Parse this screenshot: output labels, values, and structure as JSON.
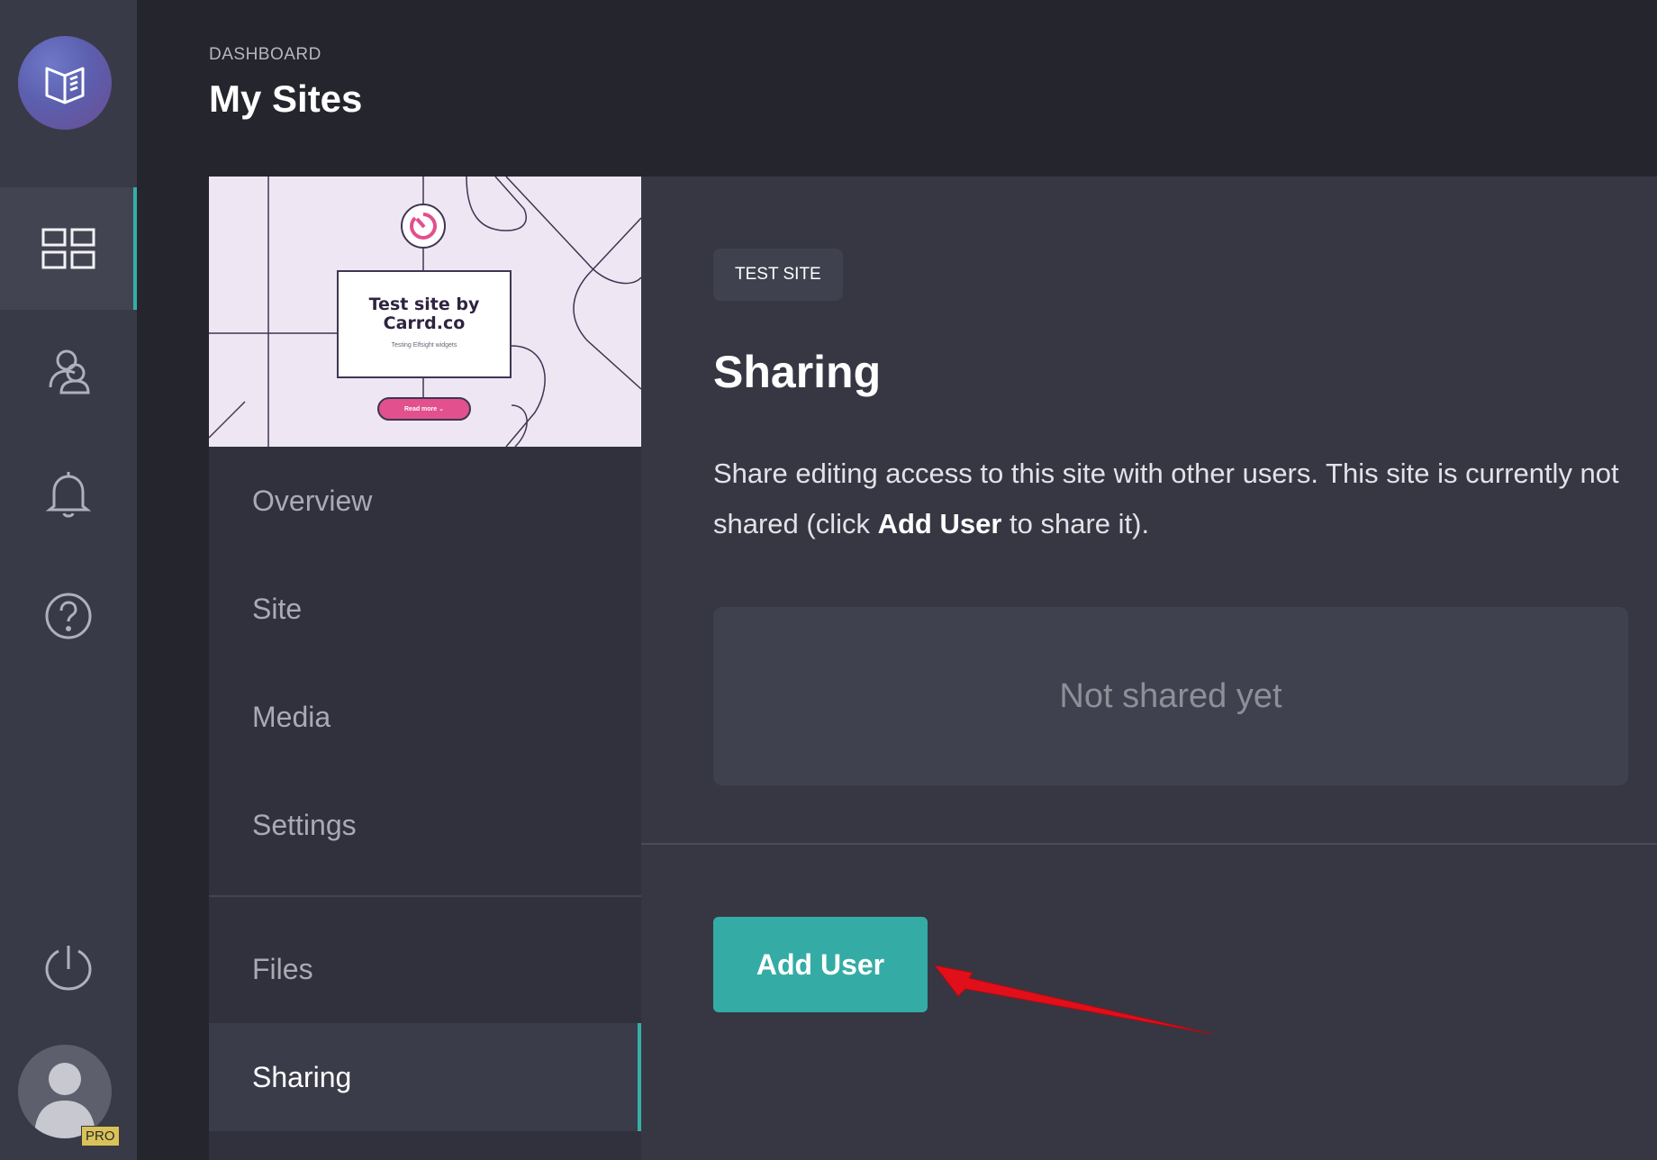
{
  "header": {
    "breadcrumb": "DASHBOARD",
    "title": "My Sites"
  },
  "rail": {
    "items": [
      {
        "name": "dashboard",
        "icon": "grid-icon",
        "active": true
      },
      {
        "name": "users",
        "icon": "users-icon"
      },
      {
        "name": "notifications",
        "icon": "bell-icon"
      },
      {
        "name": "help",
        "icon": "question-icon"
      },
      {
        "name": "logout",
        "icon": "power-icon"
      }
    ],
    "badge": "PRO"
  },
  "site_preview": {
    "title": "Test site by Carrd.co",
    "subtitle": "Testing Elfsight widgets",
    "button": "Read more"
  },
  "site_nav": {
    "items": [
      {
        "label": "Overview"
      },
      {
        "label": "Site"
      },
      {
        "label": "Media"
      },
      {
        "label": "Settings"
      },
      {
        "label": "Files"
      },
      {
        "label": "Sharing",
        "active": true
      }
    ]
  },
  "main": {
    "tag": "TEST SITE",
    "heading": "Sharing",
    "description_before": "Share editing access to this site with other users. This site is currently not shared (click ",
    "description_bold": "Add User",
    "description_after": " to share it).",
    "empty_state": "Not shared yet",
    "add_button": "Add User"
  },
  "colors": {
    "accent": "#34aca5",
    "annotation_arrow": "#e10f1a",
    "preview_pink": "#e2508d"
  }
}
